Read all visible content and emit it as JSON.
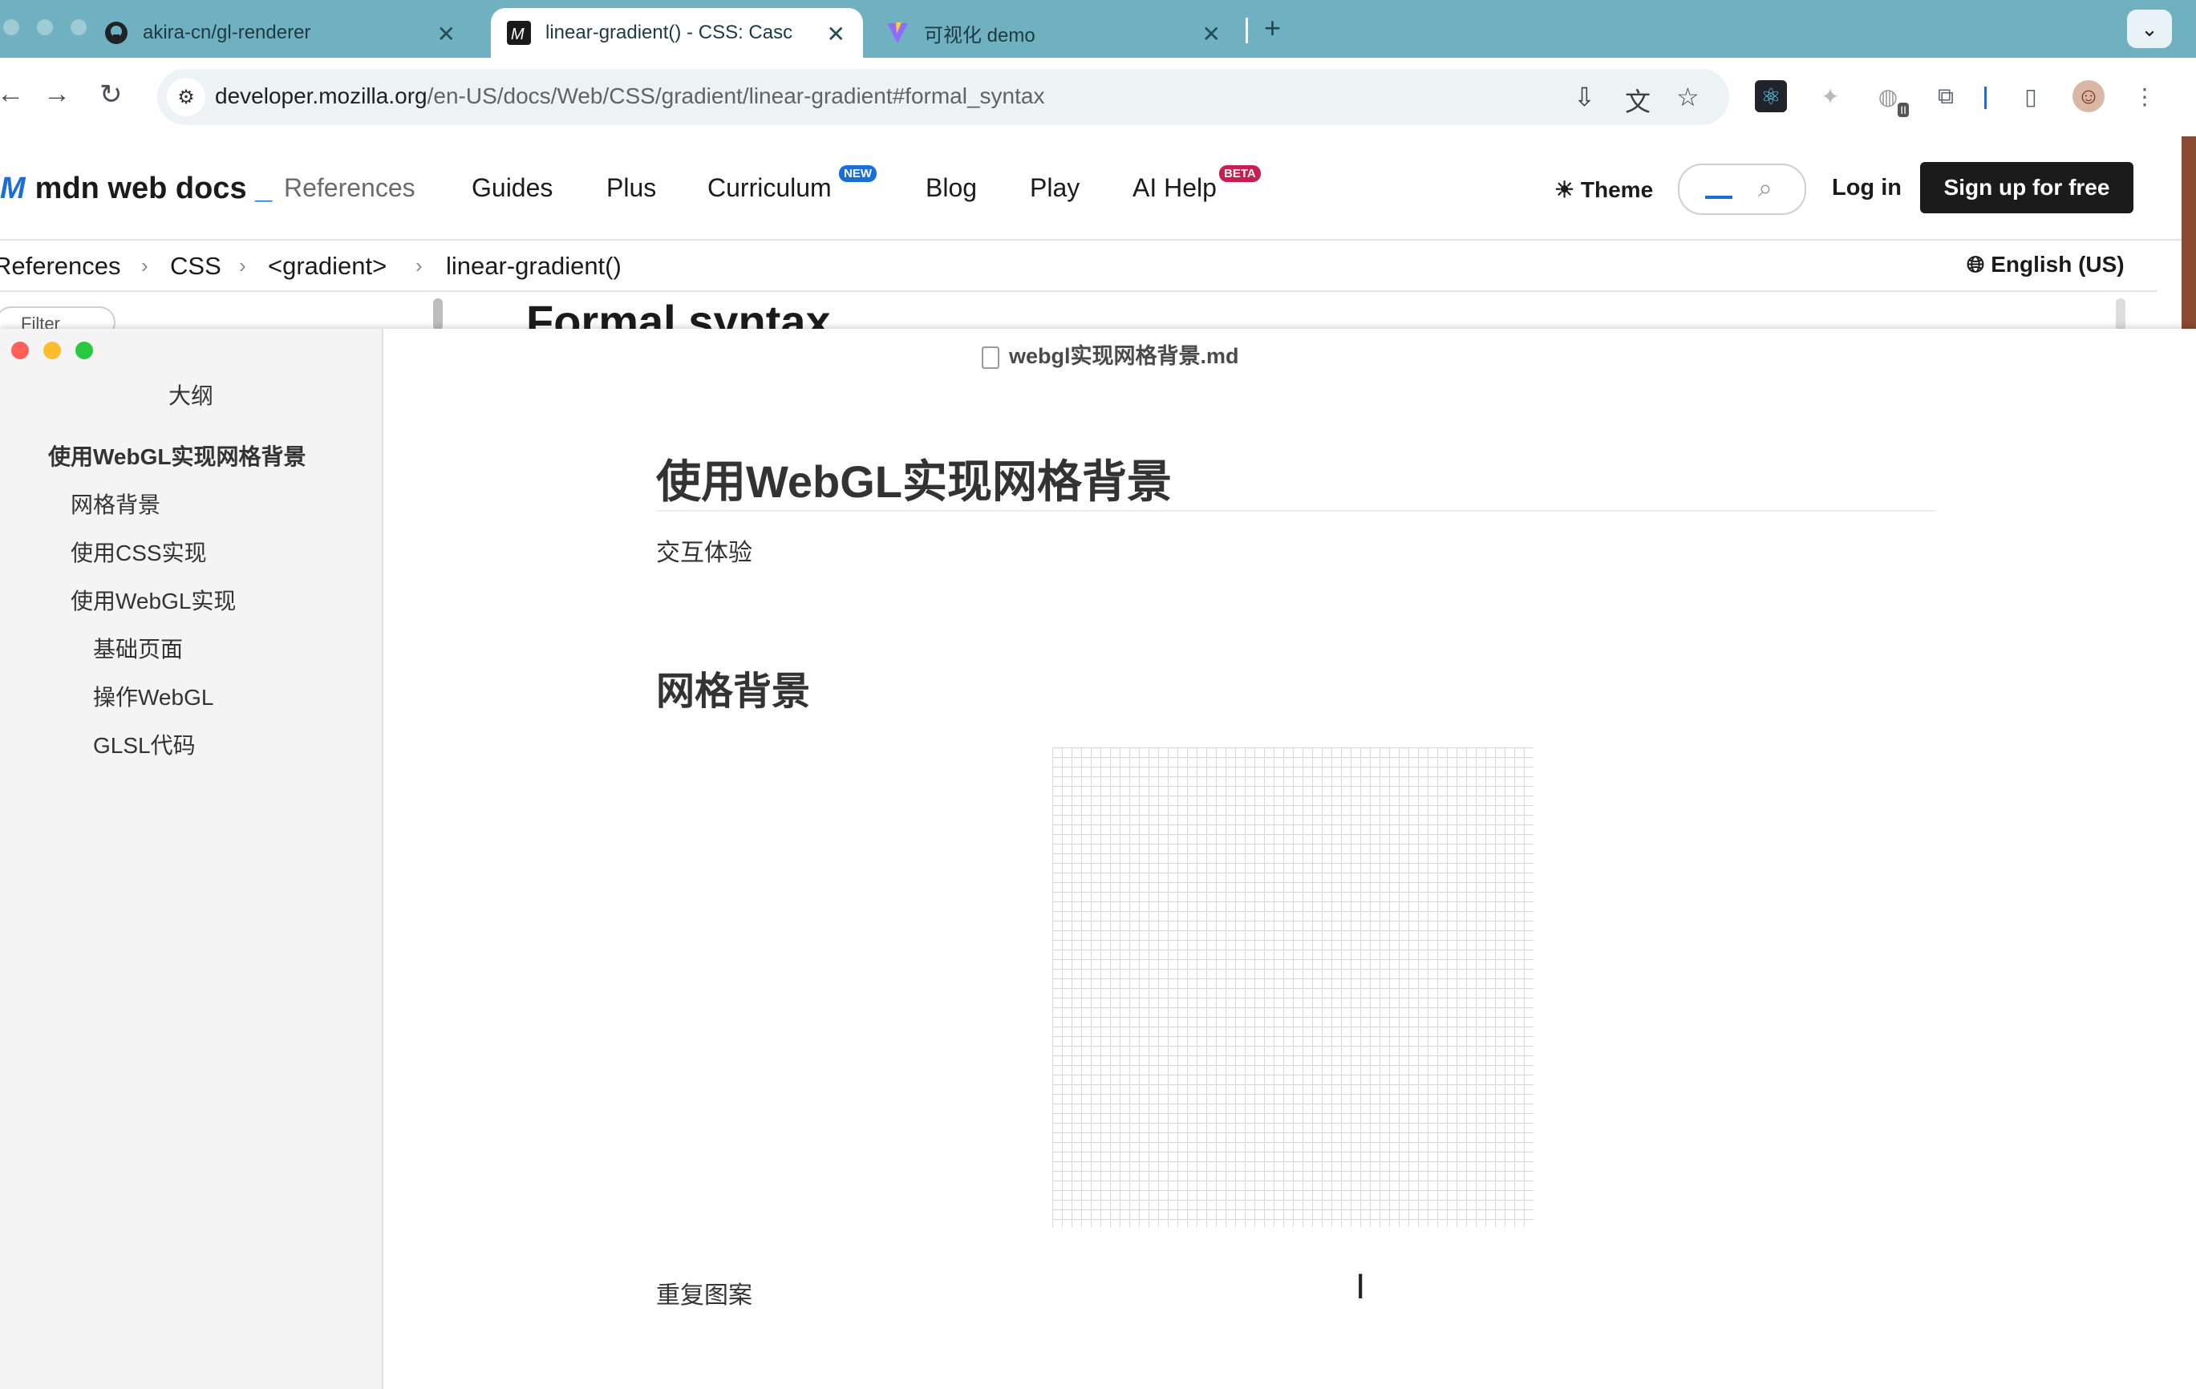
{
  "browser": {
    "tabs": [
      {
        "title": "akira-cn/gl-renderer",
        "icon": "github-icon"
      },
      {
        "title": "linear-gradient() - CSS: Casc",
        "icon": "mdn-icon",
        "active": true
      },
      {
        "title": "可视化 demo",
        "icon": "vite-icon"
      }
    ],
    "new_tab": "+",
    "tab_menu": "⌄",
    "url_host": "developer.mozilla.org",
    "url_path": "/en-US/docs/Web/CSS/gradient/linear-gradient#formal_syntax",
    "extension_badge": "II"
  },
  "mdn": {
    "logo": "mdn web docs",
    "logo_mark": "M",
    "logo_cursor": "_",
    "nav": [
      "References",
      "Guides",
      "Plus",
      "Curriculum",
      "Blog",
      "Play",
      "AI Help"
    ],
    "curriculum_badge": "NEW",
    "aihelp_badge": "BETA",
    "theme": "Theme",
    "login": "Log in",
    "signup": "Sign up for free",
    "breadcrumbs": [
      "References",
      "CSS",
      "<gradient>",
      "linear-gradient()"
    ],
    "language": "English (US)",
    "filter_placeholder": "Filter",
    "peek_heading": "Formal syntax"
  },
  "typora": {
    "filename": "webgl实现网格背景.md",
    "outline_title": "大纲",
    "outline": [
      {
        "label": "使用WebGL实现网格背景",
        "level": 1
      },
      {
        "label": "网格背景",
        "level": 2
      },
      {
        "label": "使用CSS实现",
        "level": 2
      },
      {
        "label": "使用WebGL实现",
        "level": 2
      },
      {
        "label": "基础页面",
        "level": 3
      },
      {
        "label": "操作WebGL",
        "level": 3
      },
      {
        "label": "GLSL代码",
        "level": 3
      }
    ],
    "doc": {
      "h1": "使用WebGL实现网格背景",
      "p1": "交互体验",
      "h2": "网格背景",
      "p2": "重复图案"
    }
  },
  "colors": {
    "tabstrip": "#6fb1c0",
    "mdn_blue": "#1b6ed4",
    "new_badge": "#1b6ed4",
    "beta_badge": "#c61f52",
    "traffic_red": "#ff5f57",
    "traffic_yellow": "#febc2e",
    "traffic_green": "#28c840"
  }
}
